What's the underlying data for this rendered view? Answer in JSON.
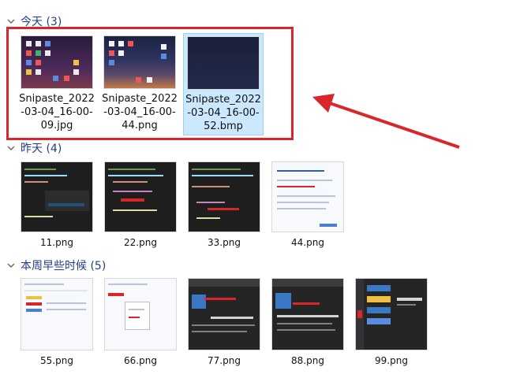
{
  "colors": {
    "header_text": "#1e3f8a",
    "selection_bg": "#cce8ff",
    "highlight": "#d9262b"
  },
  "groups": [
    {
      "title": "今天 (3)",
      "files": [
        "Snipaste_2022-03-04_16-00-09.jpg",
        "Snipaste_2022-03-04_16-00-44.png",
        "Snipaste_2022-03-04_16-00-52.bmp"
      ]
    },
    {
      "title": "昨天 (4)",
      "files": [
        "11.png",
        "22.png",
        "33.png",
        "44.png"
      ]
    },
    {
      "title": "本周早些时候 (5)",
      "files": [
        "55.png",
        "66.png",
        "77.png",
        "88.png",
        "99.png"
      ]
    }
  ],
  "selected_file": "Snipaste_2022-03-04_16-00-52.bmp"
}
